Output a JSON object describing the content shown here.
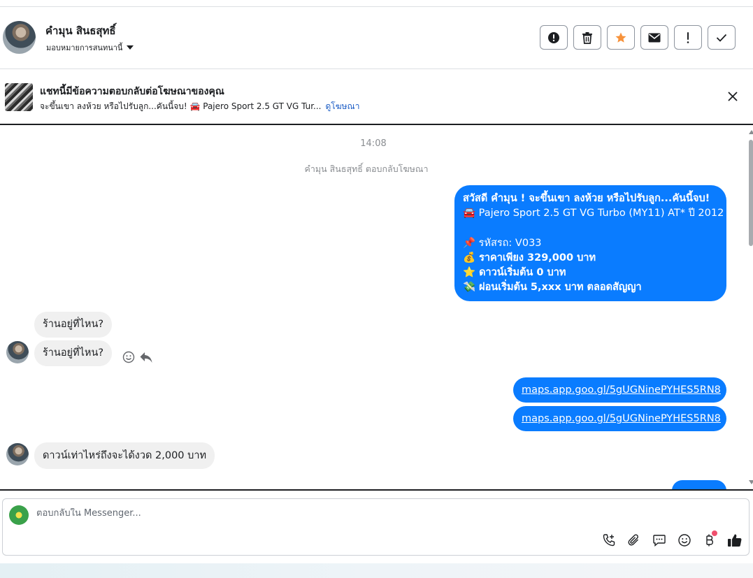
{
  "header": {
    "contact_name": "คำมุน สินธสุทธิ์",
    "assign_label": "มอบหมายการสนทนานี้",
    "actions": [
      {
        "icon": "alert-circle-icon",
        "label": "Mark as spam"
      },
      {
        "icon": "trash-icon",
        "label": "Delete"
      },
      {
        "icon": "star-icon",
        "label": "Star",
        "color": "#f7923b"
      },
      {
        "icon": "envelope-icon",
        "label": "Mark as unread"
      },
      {
        "icon": "exclamation-icon",
        "label": "Follow up"
      },
      {
        "icon": "checkmark-icon",
        "label": "Done"
      }
    ]
  },
  "ad_banner": {
    "title": "แชทนี้มีข้อความตอบกลับต่อโฆษณาของคุณ",
    "subtitle": "จะขึ้นเขา ลงห้วย หรือไปรับลูก...คันนี้จบ! 🚘 Pajero Sport 2.5 GT VG Tur...",
    "link": "ดูโฆษณา"
  },
  "chat": {
    "timestamp": "14:08",
    "system_note": "คำมุน สินธสุทธิ์ ตอบกลับโฆษณา",
    "outgoing_ad_message": {
      "lines": [
        "สวัสดี คำมุน ! จะขึ้นเขา ลงห้วย หรือไปรับลูก...คันนี้จบ!",
        "🚘 Pajero Sport 2.5 GT VG Turbo (MY11) AT* ปี 2012",
        "",
        "📌 รหัสรถ: V033",
        "💰 ราคาเพียง 329,000 บาท",
        "⭐ ดาวน์เริ่มต้น 0 บาท",
        "💸 ผ่อนเริ่มต้น 5,xxx บาท ตลอดสัญญา"
      ]
    },
    "incoming_1": "ร้านอยู่ที่ไหน?",
    "incoming_2": "ร้านอยู่ที่ไหน?",
    "link_1": "maps.app.goo.gl/5gUGNinePYHES5RN8",
    "link_2": "maps.app.goo.gl/5gUGNinePYHES5RN8",
    "incoming_3": "ดาวน์เท่าไหร่ถึงจะได้งวด 2,000 บาท",
    "bubble_color": "#0a7cff"
  },
  "composer": {
    "placeholder": "ตอบกลับใน Messenger...",
    "tools": [
      "phone-plus-icon",
      "paperclip-icon",
      "chat-bubble-icon",
      "smiley-icon",
      "baht-icon",
      "thumbs-up-icon"
    ]
  }
}
